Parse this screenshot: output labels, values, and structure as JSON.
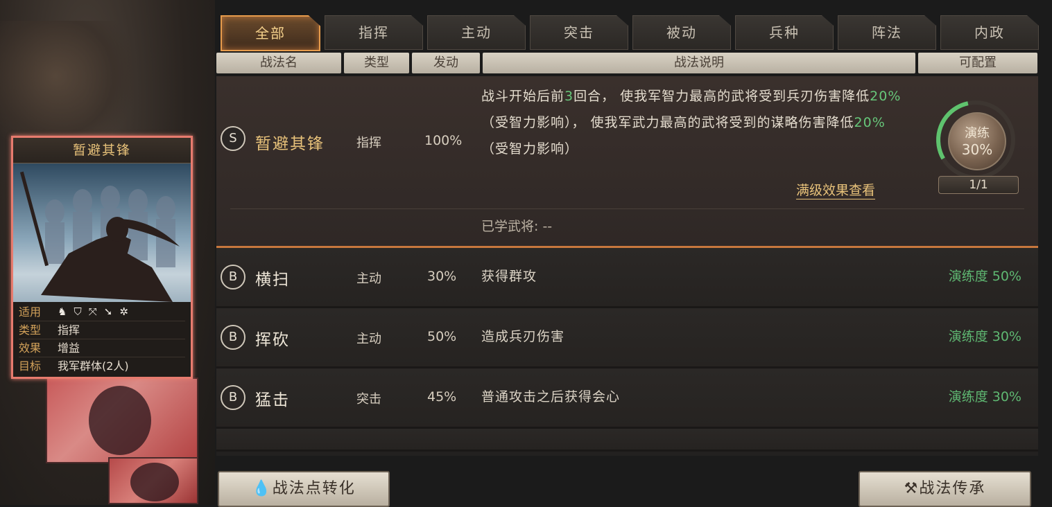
{
  "tabs": [
    {
      "label": "全部",
      "active": true
    },
    {
      "label": "指挥",
      "active": false
    },
    {
      "label": "主动",
      "active": false
    },
    {
      "label": "突击",
      "active": false
    },
    {
      "label": "被动",
      "active": false
    },
    {
      "label": "兵种",
      "active": false
    },
    {
      "label": "阵法",
      "active": false
    },
    {
      "label": "内政",
      "active": false
    }
  ],
  "columns": {
    "name": "战法名",
    "type": "类型",
    "trigger": "发动",
    "desc": "战法说明",
    "config": "可配置"
  },
  "card": {
    "title": "暂避其锋",
    "applicable_label": "适用",
    "unit_icons": [
      "cavalry-icon",
      "shield-icon",
      "bow-icon",
      "spear-icon",
      "wheel-icon"
    ],
    "type_label": "类型",
    "type_value": "指挥",
    "effect_label": "效果",
    "effect_value": "增益",
    "target_label": "目标",
    "target_value": "我军群体(2人)"
  },
  "expanded": {
    "grade": "S",
    "name": "暂避其锋",
    "type": "指挥",
    "rate": "100%",
    "desc_part1": "战斗开始后前",
    "desc_turns": "3",
    "desc_part2": "回合， 使我军智力最高的武将受到兵刃伤害降低",
    "desc_pct1": "20%",
    "desc_part3": "（受智力影响）， 使我军武力最高的武将受到的谋略伤害降低",
    "desc_pct2": "20%",
    "desc_part4": "（受智力影响）",
    "full_effect_link": "满级效果查看",
    "learned_text": "已学武将: --",
    "practice_label": "演练",
    "practice_pct": "30%",
    "practice_fraction": 0.3,
    "count": "1/1"
  },
  "rows": [
    {
      "grade": "B",
      "name": "横扫",
      "type": "主动",
      "rate": "30%",
      "desc": "获得群攻",
      "mastery": "演练度 50%"
    },
    {
      "grade": "B",
      "name": "挥砍",
      "type": "主动",
      "rate": "50%",
      "desc": "造成兵刃伤害",
      "mastery": "演练度 30%"
    },
    {
      "grade": "B",
      "name": "猛击",
      "type": "突击",
      "rate": "45%",
      "desc": "普通攻击之后获得会心",
      "mastery": "演练度 30%"
    }
  ],
  "buttons": {
    "convert": "战法点转化",
    "inherit": "战法传承"
  },
  "colors": {
    "gold": "#e8c27a",
    "green": "#67c77a",
    "accent_orange": "#e79c4c",
    "card_border": "#e77b6e"
  }
}
